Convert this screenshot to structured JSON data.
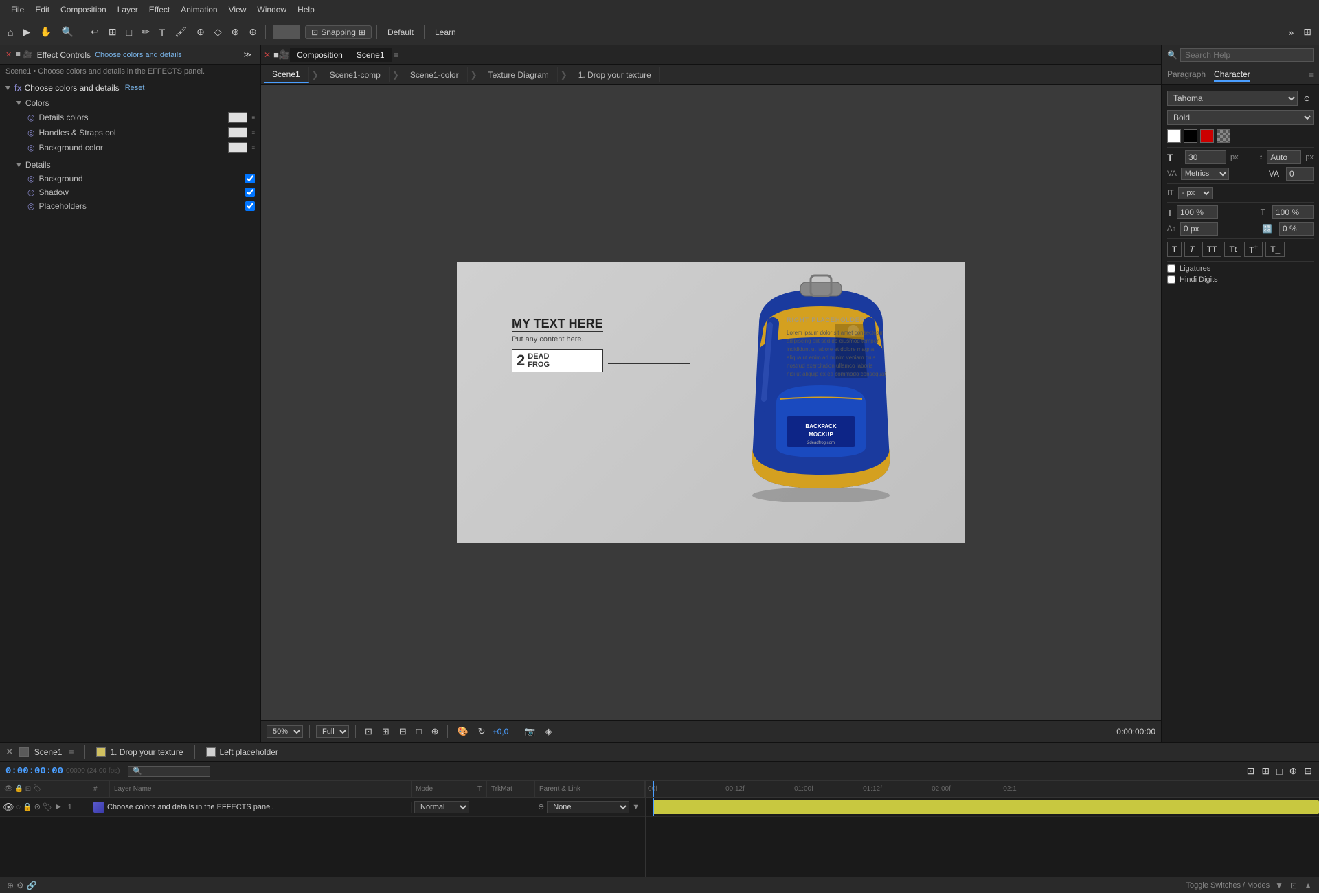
{
  "menu": {
    "items": [
      "File",
      "Edit",
      "Composition",
      "Layer",
      "Effect",
      "Animation",
      "View",
      "Window",
      "Help"
    ]
  },
  "toolbar": {
    "snapping_label": "Snapping",
    "default_label": "Default",
    "learn_label": "Learn"
  },
  "left_panel": {
    "title": "Effect Controls",
    "subtitle": "Choose colors and details in the EFFECTS panel.",
    "breadcrumb": "Scene1 • Choose colors and details in the EFFECTS panel.",
    "effect_name": "Choose colors and details",
    "reset_label": "Reset",
    "colors_label": "Colors",
    "color_items": [
      {
        "name": "Details colors",
        "swatch": "#e0e0e0"
      },
      {
        "name": "Handles & Straps col",
        "swatch": "#e0e0e0"
      },
      {
        "name": "Background color",
        "swatch": "#e0e0e0"
      }
    ],
    "details_label": "Details",
    "detail_items": [
      {
        "name": "Background",
        "checked": true
      },
      {
        "name": "Shadow",
        "checked": true
      },
      {
        "name": "Placeholders",
        "checked": true
      }
    ]
  },
  "composition": {
    "header_title": "Composition",
    "comp_name": "Scene1",
    "tabs": [
      "Scene1",
      "Scene1-comp",
      "Scene1-color",
      "Texture Diagram",
      "1. Drop your texture"
    ]
  },
  "canvas": {
    "text_main": "MY TEXT HERE",
    "text_sub": "Put any content here.",
    "logo_num": "2",
    "logo_text": "DEAD\nFROG",
    "placeholder_right": "RIGHT PLACEHOLDER",
    "backpack_label": "BACKPACK\nMOCKUP",
    "zoom": "50%",
    "quality": "Full",
    "time": "0:00:00:00",
    "plus_zero": "+0,0"
  },
  "right_panel": {
    "search_placeholder": "Search Help",
    "tabs": [
      "Paragraph",
      "Character"
    ],
    "active_tab": "Character",
    "font_name": "Tahoma",
    "font_style": "Bold",
    "font_size": "30",
    "font_size_unit": "px",
    "auto_label": "Auto",
    "auto_unit": "px",
    "metrics_label": "Metrics",
    "va_label": "0",
    "px_label": "px",
    "scale_h": "100 %",
    "scale_v": "100 %",
    "baseline": "0 px",
    "tracking": "0 %",
    "ligatures_label": "Ligatures",
    "hindi_label": "Hindi Digits"
  },
  "timeline": {
    "comp_name": "Scene1",
    "time_display": "0:00:00:00",
    "fps_label": "00000 (24.00 fps)",
    "layer_tabs": [
      "1. Drop your texture",
      "Left placeholder"
    ],
    "layer_tab_colors": [
      "#d0c060",
      "#d0d0d0"
    ],
    "columns": [
      "",
      "",
      "",
      "",
      "",
      "#",
      "Layer Name",
      "Mode",
      "T",
      "TrkMat",
      "Parent & Link"
    ],
    "layers": [
      {
        "num": "1",
        "name": "Choose colors and details in the EFFECTS panel.",
        "mode": "Normal",
        "parent": "None",
        "has_eye": true
      }
    ],
    "ruler_marks": [
      "00f",
      "00:12f",
      "01:00f",
      "01:12f",
      "02:00f",
      "02:1"
    ]
  }
}
